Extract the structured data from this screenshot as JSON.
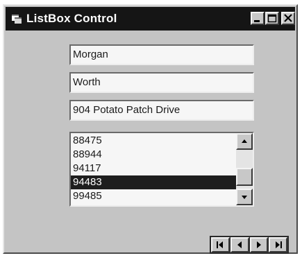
{
  "window": {
    "title": "ListBox Control",
    "app_icon": "vb-form-icon",
    "caption_buttons": [
      "minimize-icon",
      "maximize-icon",
      "close-icon"
    ]
  },
  "form": {
    "name_field": "Morgan",
    "last_name_field": "Worth",
    "address_field": "904 Potato Patch Drive"
  },
  "listbox": {
    "items": [
      "88475",
      "88944",
      "94117",
      "94483",
      "99485"
    ],
    "selected_index": 3,
    "scroll_position_fraction": 0.5
  },
  "navigator": {
    "buttons": [
      "first-record-icon",
      "previous-record-icon",
      "next-record-icon",
      "last-record-icon"
    ]
  },
  "colors": {
    "titlebar": "#151515",
    "window_face": "#c4c4c4",
    "selection": "#1e1e1e"
  }
}
